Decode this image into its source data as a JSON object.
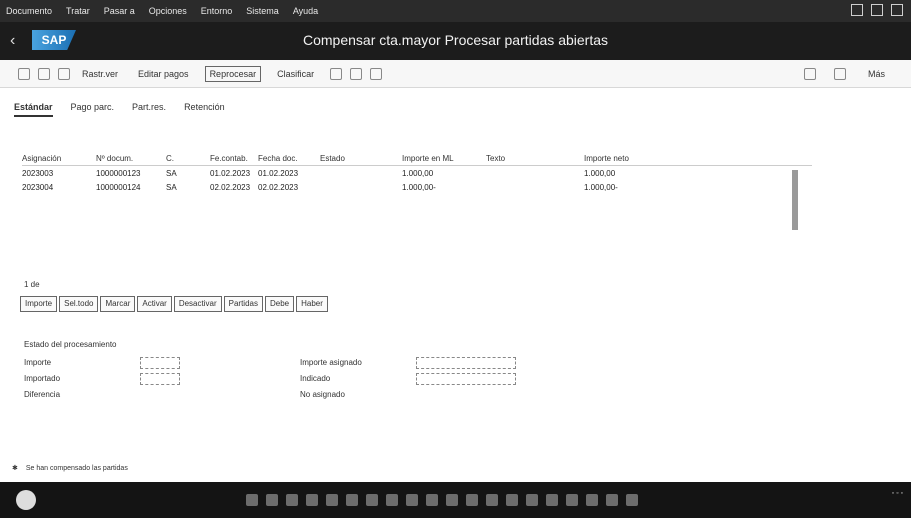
{
  "menubar": {
    "items": [
      "Documento",
      "Tratar",
      "Pasar a",
      "Opciones",
      "Entorno",
      "Sistema",
      "Ayuda"
    ]
  },
  "titlebar": {
    "back_glyph": "‹",
    "logo": "SAP",
    "title": "Compensar cta.mayor Procesar partidas abiertas"
  },
  "toolbar": {
    "buttons": [
      "Rastr.ver",
      "Editar pagos",
      "Reprocesar",
      "Clasificar"
    ],
    "more_label": "Más"
  },
  "tabs": [
    "Estándar",
    "Pago parc.",
    "Part.res.",
    "Retención"
  ],
  "grid": {
    "headers": [
      "Asignación",
      "Nº docum.",
      "C.",
      "Fe.contab.",
      "Fecha doc.",
      "Estado",
      "Importe en ML",
      "Texto",
      "Importe neto",
      ""
    ],
    "rows": [
      [
        "2023003",
        "1000000123",
        "SA",
        "01.02.2023",
        "01.02.2023",
        "",
        "1.000,00",
        "",
        "1.000,00",
        ""
      ],
      [
        "2023004",
        "1000000124",
        "SA",
        "02.02.2023",
        "02.02.2023",
        "",
        "1.000,00-",
        "",
        "1.000,00-",
        ""
      ]
    ]
  },
  "rowcount": "1 de",
  "actions": [
    "Importe",
    "Sel.todo",
    "Marcar",
    "Activar",
    "Desactivar",
    "Partidas",
    "Debe",
    "Haber"
  ],
  "controls": {
    "section_title": "Estado del procesamiento",
    "labels": [
      "Importe",
      "Importado",
      "Diferencia",
      "Importe asignado",
      "Indicado",
      "No asignado"
    ]
  },
  "status_text": "Se han compensado las partidas"
}
